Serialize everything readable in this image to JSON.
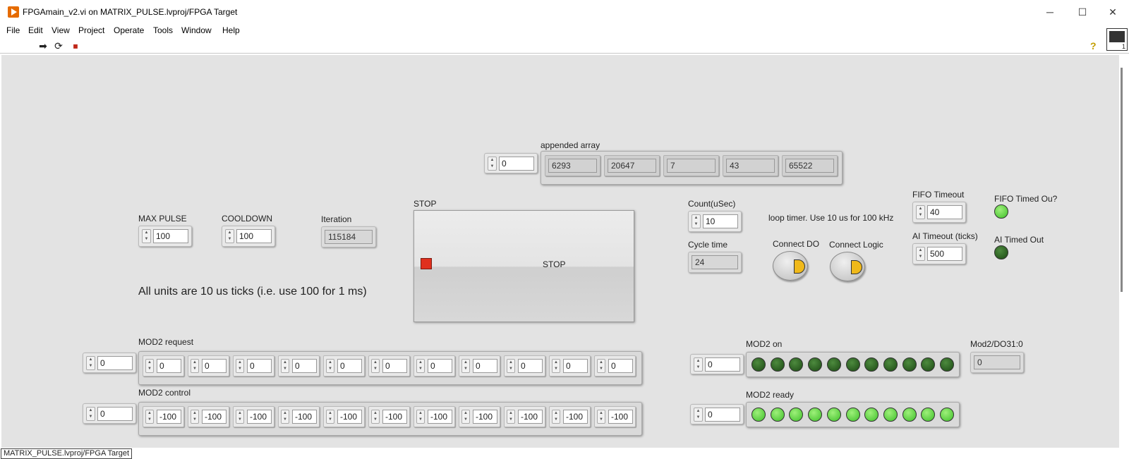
{
  "window": {
    "title": "FPGAmain_v2.vi on MATRIX_PULSE.lvproj/FPGA Target",
    "min": "─",
    "max": "☐",
    "close": "✕"
  },
  "menu": [
    "File",
    "Edit",
    "View",
    "Project",
    "Operate",
    "Tools",
    "Window",
    "Help"
  ],
  "toolbar": {
    "run": "➡",
    "run_cont": "⟳",
    "abort": "⏹",
    "help": "?",
    "vi_icon_num": "1"
  },
  "appended_array": {
    "label": "appended array",
    "index": "0",
    "values": [
      "6293",
      "20647",
      "7",
      "43",
      "65522"
    ]
  },
  "max_pulse": {
    "label": "MAX PULSE",
    "value": "100"
  },
  "cooldown": {
    "label": "COOLDOWN",
    "value": "100"
  },
  "iteration": {
    "label": "Iteration",
    "value": "115184"
  },
  "stop": {
    "label": "STOP",
    "text": "STOP"
  },
  "count_usec": {
    "label": "Count(uSec)",
    "value": "10"
  },
  "loop_note": "loop timer. Use 10 us for 100 kHz",
  "cycle_time": {
    "label": "Cycle time",
    "value": "24"
  },
  "connect_do": "Connect DO",
  "connect_logic": "Connect Logic",
  "fifo_timeout": {
    "label": "FIFO Timeout",
    "value": "40"
  },
  "ai_timeout": {
    "label": "AI Timeout (ticks)",
    "value": "500"
  },
  "fifo_timed_out": "FIFO Timed Ou?",
  "ai_timed_out": "AI Timed Out",
  "units_note": "All units are 10 us ticks (i.e. use 100 for 1 ms)",
  "mod2_request": {
    "label": "MOD2 request",
    "index": "0",
    "values": [
      "0",
      "0",
      "0",
      "0",
      "0",
      "0",
      "0",
      "0",
      "0",
      "0",
      "0"
    ]
  },
  "mod2_control": {
    "label": "MOD2 control",
    "index": "0",
    "values": [
      "-100",
      "-100",
      "-100",
      "-100",
      "-100",
      "-100",
      "-100",
      "-100",
      "-100",
      "-100",
      "-100"
    ]
  },
  "mod2_on": {
    "label": "MOD2 on",
    "index": "0",
    "leds": 11
  },
  "mod2_ready": {
    "label": "MOD2 ready",
    "index": "0",
    "leds": 11
  },
  "mod2_do": {
    "label": "Mod2/DO31:0",
    "value": "0"
  },
  "status": "MATRIX_PULSE.lvproj/FPGA Target",
  "colors": {
    "led_dark": "#2e6a22",
    "led_light": "#6ee04a",
    "stop_led": "#e0301e",
    "button_led": "#f0b91a"
  }
}
